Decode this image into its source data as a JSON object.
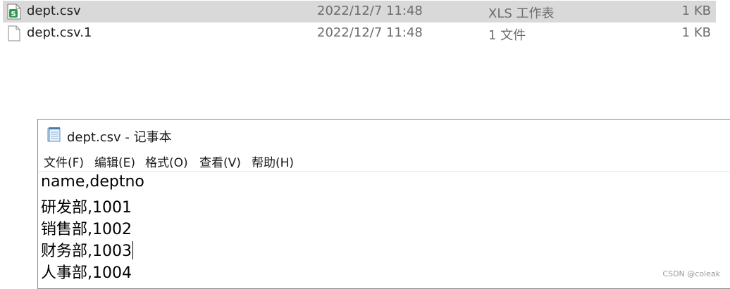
{
  "explorer": {
    "files": [
      {
        "name": "dept.csv",
        "date": "2022/12/7 11:48",
        "type": "XLS 工作表",
        "size": "1 KB",
        "icon": "spreadsheet-file-icon",
        "selected": true
      },
      {
        "name": "dept.csv.1",
        "date": "2022/12/7 11:48",
        "type": "1 文件",
        "size": "1 KB",
        "icon": "blank-file-icon",
        "selected": false
      }
    ]
  },
  "notepad": {
    "title": "dept.csv - 记事本",
    "icon": "notepad-icon",
    "menu": [
      "文件(F)",
      "编辑(E)",
      "格式(O)",
      "查看(V)",
      "帮助(H)"
    ],
    "lines": [
      "name,deptno",
      "研发部,1001",
      "销售部,1002",
      "财务部,1003",
      "人事部,1004"
    ]
  },
  "watermark": "CSDN @coleak",
  "colors": {
    "selection": "#d9d9d9",
    "spreadsheet_green": "#2e9a4a",
    "secondary_text": "#6d6d6d"
  }
}
